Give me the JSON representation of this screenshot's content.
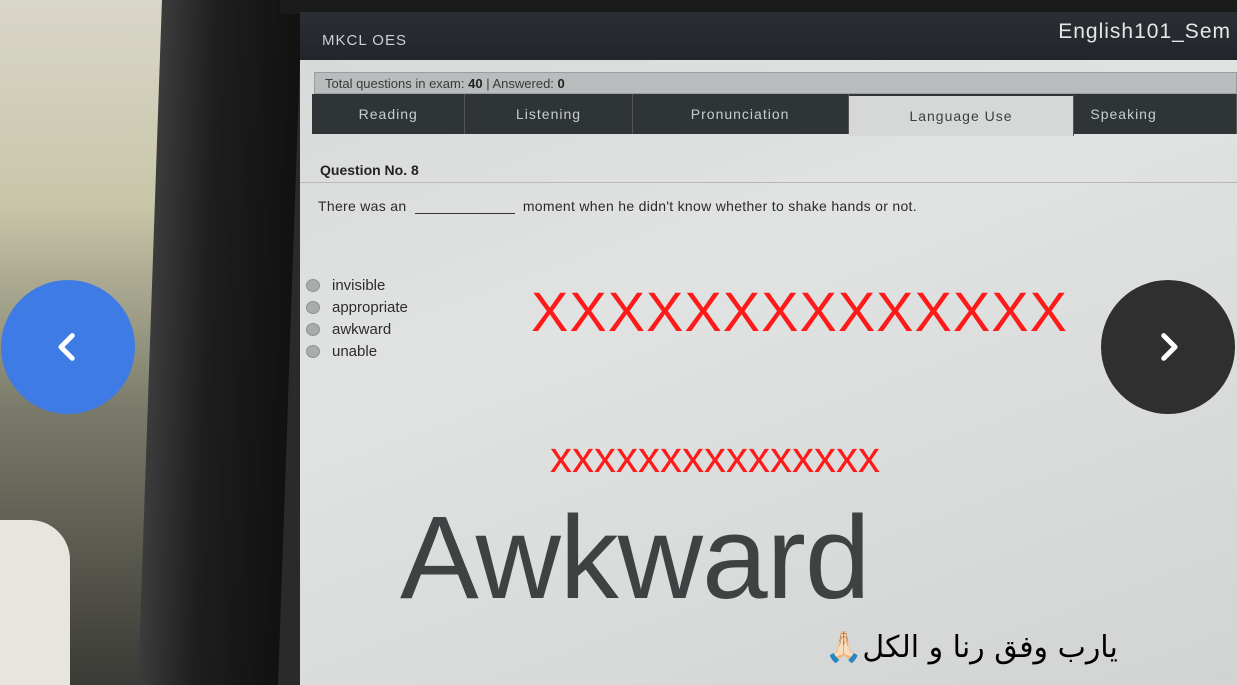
{
  "header": {
    "brand": "MKCL OES",
    "exam_name": "English101_Sem"
  },
  "info_bar": {
    "total_label": "Total questions in exam:",
    "total_value": "40",
    "separator": "|",
    "answered_label": "Answered:",
    "answered_value": "0"
  },
  "tabs": [
    {
      "label": "Reading",
      "active": false
    },
    {
      "label": "Listening",
      "active": false
    },
    {
      "label": "Pronunciation",
      "active": false
    },
    {
      "label": "Language Use",
      "active": true
    },
    {
      "label": "Speaking",
      "active": false
    }
  ],
  "question": {
    "title": "Question No. 8",
    "text_before": "There was an",
    "text_after": "moment when he didn't know whether to shake hands or not."
  },
  "options": [
    {
      "label": "invisible"
    },
    {
      "label": "appropriate"
    },
    {
      "label": "awkward"
    },
    {
      "label": "unable"
    }
  ],
  "overlay": {
    "mark_large": "XXXXXXXXXXXXXX",
    "mark_small": "xxxxxxxxxxxxxxx",
    "answer": "Awkward",
    "prayer": "يارب وفق رنا و الكل🙏🏻"
  },
  "carousel": {
    "prev_icon": "chevron-left-icon",
    "next_icon": "chevron-right-icon"
  },
  "colors": {
    "overlay_red": "#ff1a1a",
    "prev_button": "#3f7be4",
    "next_button": "#2f2f2f"
  }
}
